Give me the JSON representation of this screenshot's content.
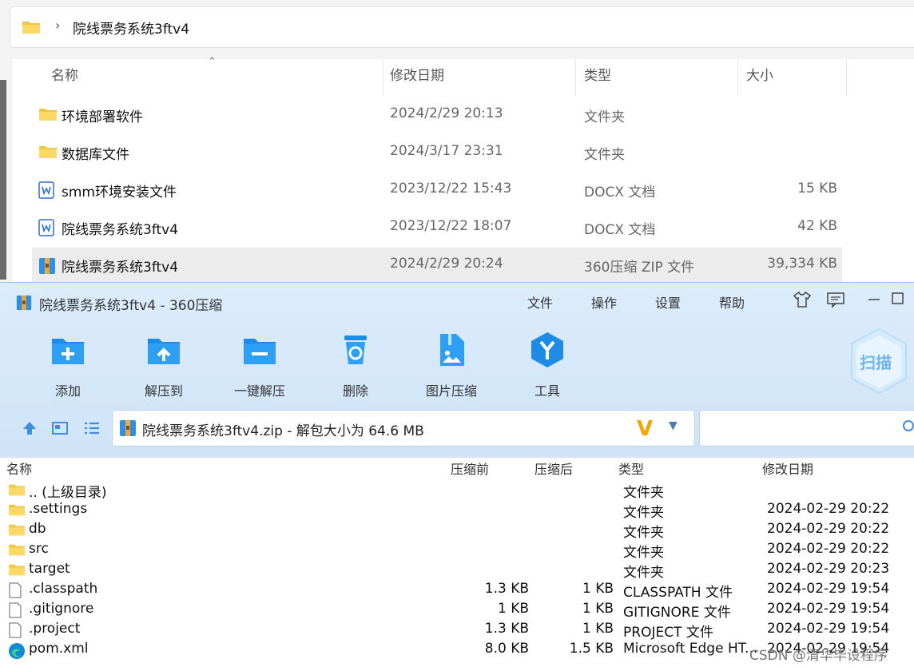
{
  "explorer": {
    "breadcrumb": "院线票务系统3ftv4",
    "columns": {
      "name": "名称",
      "date": "修改日期",
      "type": "类型",
      "size": "大小"
    },
    "rows": [
      {
        "name": "环境部署软件",
        "date": "2024/2/29 20:13",
        "type": "文件夹",
        "size": "",
        "icon": "folder-icon"
      },
      {
        "name": "数据库文件",
        "date": "2024/3/17 23:31",
        "type": "文件夹",
        "size": "",
        "icon": "folder-icon"
      },
      {
        "name": "smm环境安装文件",
        "date": "2023/12/22 15:43",
        "type": "DOCX 文档",
        "size": "15 KB",
        "icon": "docx-icon"
      },
      {
        "name": "院线票务系统3ftv4",
        "date": "2023/12/22 18:07",
        "type": "DOCX 文档",
        "size": "42 KB",
        "icon": "docx-icon"
      },
      {
        "name": "院线票务系统3ftv4",
        "date": "2024/2/29 20:24",
        "type": "360压缩 ZIP 文件",
        "size": "39,334 KB",
        "icon": "zip-icon"
      }
    ]
  },
  "zip": {
    "title": "院线票务系统3ftv4 - 360压缩",
    "menu": {
      "file": "文件",
      "ops": "操作",
      "settings": "设置",
      "help": "帮助"
    },
    "toolbar": {
      "add": "添加",
      "extract_to": "解压到",
      "one_click": "一键解压",
      "delete": "删除",
      "image_compress": "图片压缩",
      "tools": "工具",
      "scan": "扫描"
    },
    "path": "院线票务系统3ftv4.zip - 解包大小为 64.6 MB",
    "columns": {
      "name": "名称",
      "before": "压缩前",
      "after": "压缩后",
      "type": "类型",
      "date": "修改日期"
    },
    "rows": [
      {
        "name": ".. (上级目录)",
        "before": "",
        "after": "",
        "type": "文件夹",
        "date": "",
        "icon": "folder-icon"
      },
      {
        "name": ".settings",
        "before": "",
        "after": "",
        "type": "文件夹",
        "date": "2024-02-29 20:22",
        "icon": "folder-icon"
      },
      {
        "name": "db",
        "before": "",
        "after": "",
        "type": "文件夹",
        "date": "2024-02-29 20:22",
        "icon": "folder-icon"
      },
      {
        "name": "src",
        "before": "",
        "after": "",
        "type": "文件夹",
        "date": "2024-02-29 20:22",
        "icon": "folder-icon"
      },
      {
        "name": "target",
        "before": "",
        "after": "",
        "type": "文件夹",
        "date": "2024-02-29 20:23",
        "icon": "folder-icon"
      },
      {
        "name": ".classpath",
        "before": "1.3 KB",
        "after": "1 KB",
        "type": "CLASSPATH 文件",
        "date": "2024-02-29 19:54",
        "icon": "file-icon"
      },
      {
        "name": ".gitignore",
        "before": "1 KB",
        "after": "1 KB",
        "type": "GITIGNORE 文件",
        "date": "2024-02-29 19:54",
        "icon": "file-icon"
      },
      {
        "name": ".project",
        "before": "1.3 KB",
        "after": "1 KB",
        "type": "PROJECT 文件",
        "date": "2024-02-29 19:54",
        "icon": "file-icon"
      },
      {
        "name": "pom.xml",
        "before": "8.0 KB",
        "after": "1.5 KB",
        "type": "Microsoft Edge HT...",
        "date": "2024-02-29 19:54",
        "icon": "edge-icon"
      }
    ]
  },
  "watermark": "CSDN @清华毕设程序"
}
